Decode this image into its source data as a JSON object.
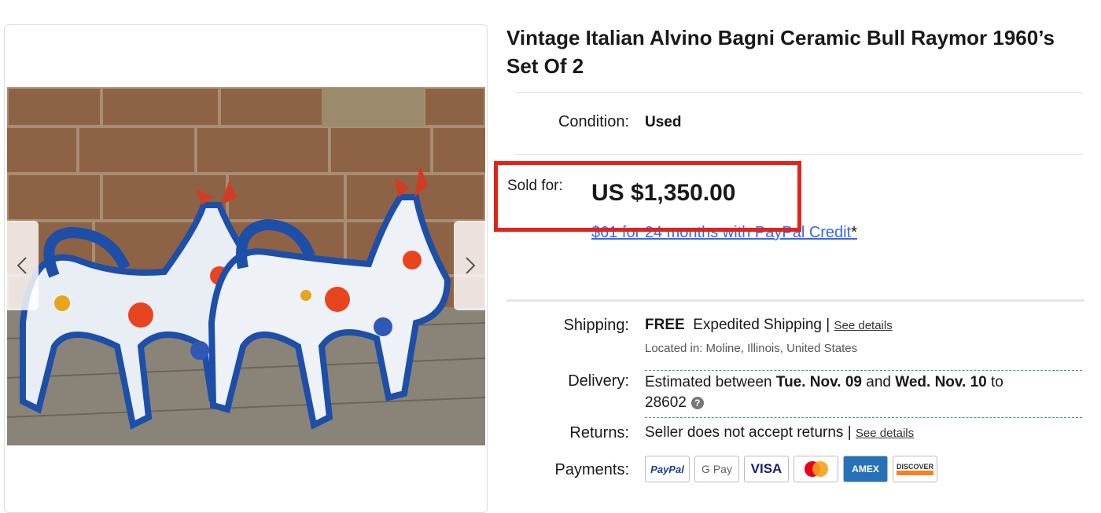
{
  "listing": {
    "title": "Vintage Italian Alvino Bagni Ceramic Bull Raymor 1960’s Set Of 2"
  },
  "condition": {
    "label": "Condition:",
    "value": "Used"
  },
  "price": {
    "label": "Sold for:",
    "value": "US $1,350.00",
    "credit_text": "$61 for 24 months with PayPal Credit",
    "credit_asterisk": "*"
  },
  "shipping": {
    "label": "Shipping:",
    "free": "FREE",
    "method": "Expedited Shipping",
    "separator": "|",
    "details_link": "See details",
    "located": "Located in:  Moline, Illinois, United States"
  },
  "delivery": {
    "label": "Delivery:",
    "prefix": "Estimated between ",
    "start": "Tue. Nov. 09",
    "middle": " and ",
    "end": "Wed. Nov. 10",
    "suffix": " to",
    "zip": "28602",
    "help": "?"
  },
  "returns": {
    "label": "Returns:",
    "value": "Seller does not accept returns",
    "separator": "|",
    "details_link": "See details"
  },
  "payments": {
    "label": "Payments:",
    "methods": [
      "PayPal",
      "G Pay",
      "VISA",
      "Mastercard",
      "AMEX",
      "DISCOVER"
    ]
  },
  "colors": {
    "highlight": "#e2231a",
    "link": "#3665f3"
  }
}
